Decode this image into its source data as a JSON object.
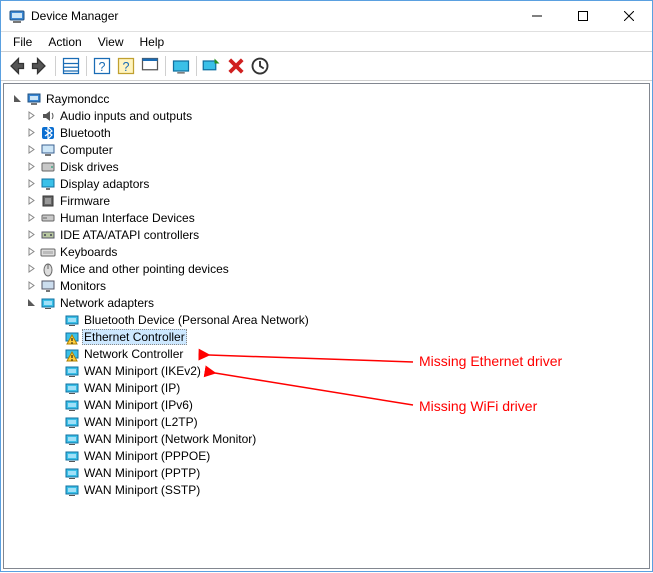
{
  "window": {
    "title": "Device Manager"
  },
  "menu": {
    "items": [
      "File",
      "Action",
      "View",
      "Help"
    ]
  },
  "toolbar_icons": [
    "back",
    "forward",
    "properties",
    "help-alt",
    "help",
    "app",
    "show-hidden",
    "scan",
    "update",
    "uninstall",
    "action"
  ],
  "tree": {
    "root": {
      "label": "Raymondcc",
      "children": [
        {
          "label": "Audio inputs and outputs",
          "icon": "audio",
          "expandable": true
        },
        {
          "label": "Bluetooth",
          "icon": "bluetooth",
          "expandable": true
        },
        {
          "label": "Computer",
          "icon": "computer",
          "expandable": true
        },
        {
          "label": "Disk drives",
          "icon": "disk",
          "expandable": true
        },
        {
          "label": "Display adaptors",
          "icon": "display",
          "expandable": true
        },
        {
          "label": "Firmware",
          "icon": "firmware",
          "expandable": true
        },
        {
          "label": "Human Interface Devices",
          "icon": "hid",
          "expandable": true
        },
        {
          "label": "IDE ATA/ATAPI controllers",
          "icon": "ide",
          "expandable": true
        },
        {
          "label": "Keyboards",
          "icon": "keyboard",
          "expandable": true
        },
        {
          "label": "Mice and other pointing devices",
          "icon": "mouse",
          "expandable": true
        },
        {
          "label": "Monitors",
          "icon": "monitor",
          "expandable": true
        },
        {
          "label": "Network adapters",
          "icon": "network",
          "expandable": true,
          "expanded": true,
          "children": [
            {
              "label": "Bluetooth Device (Personal Area Network)",
              "icon": "network"
            },
            {
              "label": "Ethernet Controller",
              "icon": "warning",
              "selected": true
            },
            {
              "label": "Network Controller",
              "icon": "warning"
            },
            {
              "label": "WAN Miniport (IKEv2)",
              "icon": "network"
            },
            {
              "label": "WAN Miniport (IP)",
              "icon": "network"
            },
            {
              "label": "WAN Miniport (IPv6)",
              "icon": "network"
            },
            {
              "label": "WAN Miniport (L2TP)",
              "icon": "network"
            },
            {
              "label": "WAN Miniport (Network Monitor)",
              "icon": "network"
            },
            {
              "label": "WAN Miniport (PPPOE)",
              "icon": "network"
            },
            {
              "label": "WAN Miniport (PPTP)",
              "icon": "network"
            },
            {
              "label": "WAN Miniport (SSTP)",
              "icon": "network"
            }
          ]
        }
      ]
    }
  },
  "annotations": [
    {
      "text": "Missing Ethernet driver"
    },
    {
      "text": "Missing WiFi driver"
    }
  ]
}
